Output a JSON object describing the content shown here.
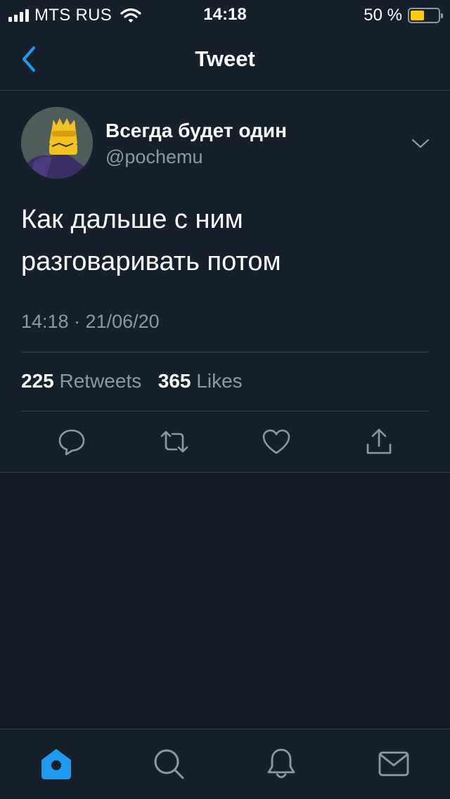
{
  "status_bar": {
    "carrier": "MTS RUS",
    "time": "14:18",
    "battery_percent": "50 %",
    "battery_level": 0.5
  },
  "nav": {
    "title": "Tweet"
  },
  "tweet": {
    "display_name": "Всегда будет один",
    "username": "@pochemu",
    "text": "Как дальше с ним разговаривать потом",
    "timestamp": "14:18 · 21/06/20",
    "retweets_count": "225",
    "retweets_label": "Retweets",
    "likes_count": "365",
    "likes_label": "Likes"
  },
  "icons": {
    "back": "chevron-left-icon",
    "more": "chevron-down-icon",
    "reply": "reply-icon",
    "retweet": "retweet-icon",
    "like": "heart-icon",
    "share": "share-icon",
    "home": "home-icon",
    "search": "search-icon",
    "notifications": "bell-icon",
    "messages": "mail-icon"
  },
  "colors": {
    "background": "#15202b",
    "empty_background": "#141a23",
    "accent": "#1d9bf0",
    "secondary_text": "#8b98a5",
    "divider": "#38444d",
    "battery": "#ffcc00"
  }
}
